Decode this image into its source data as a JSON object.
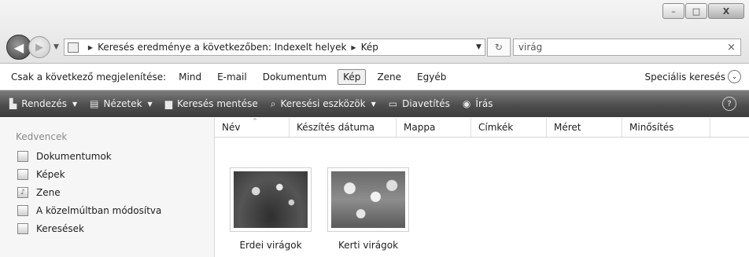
{
  "window": {
    "controls": {
      "minimize": "–",
      "maximize": "□",
      "close": "X"
    }
  },
  "nav": {
    "back_glyph": "◀",
    "forward_glyph": "▶",
    "history_drop": "▼",
    "breadcrumb": [
      "Keresés eredménye a következőben: Indexelt helyek",
      "Kép"
    ],
    "breadcrumb_sep": "▶",
    "address_drop": "▼",
    "refresh_glyph": "↻",
    "search_value": "virág",
    "search_clear": "×"
  },
  "filterbar": {
    "label": "Csak a következő megjelenítése:",
    "items": [
      "Mind",
      "E-mail",
      "Dokumentum",
      "Kép",
      "Zene",
      "Egyéb"
    ],
    "active_index": 3,
    "advanced": "Speciális keresés",
    "advanced_glyph": "⌄"
  },
  "toolbar": {
    "items": [
      {
        "label": "Rendezés",
        "icon": "organize-icon",
        "glyph": "▙",
        "dropdown": true
      },
      {
        "label": "Nézetek",
        "icon": "views-icon",
        "glyph": "▤",
        "dropdown": true
      },
      {
        "label": "Keresés mentése",
        "icon": "save-search-icon",
        "glyph": "▆",
        "dropdown": false
      },
      {
        "label": "Keresési eszközök",
        "icon": "search-tools-icon",
        "glyph": "⌕",
        "dropdown": true
      },
      {
        "label": "Diavetítés",
        "icon": "slideshow-icon",
        "glyph": "▭",
        "dropdown": false
      },
      {
        "label": "Írás",
        "icon": "burn-icon",
        "glyph": "◉",
        "dropdown": false
      }
    ],
    "dropdown_glyph": "▼",
    "help_glyph": "?"
  },
  "sidebar": {
    "heading": "Kedvencek",
    "items": [
      {
        "label": "Dokumentumok",
        "icon": "documents-icon",
        "glyph": ""
      },
      {
        "label": "Képek",
        "icon": "pictures-icon",
        "glyph": ""
      },
      {
        "label": "Zene",
        "icon": "music-icon",
        "glyph": "♪"
      },
      {
        "label": "A közelmúltban módosítva",
        "icon": "recent-icon",
        "glyph": ""
      },
      {
        "label": "Keresések",
        "icon": "searches-icon",
        "glyph": ""
      }
    ]
  },
  "list": {
    "sort_glyph": "^",
    "columns": [
      "Név",
      "Készítés dátuma",
      "Mappa",
      "Címkék",
      "Méret",
      "Minősítés"
    ],
    "files": [
      {
        "name": "Erdei virágok"
      },
      {
        "name": "Kerti virágok"
      }
    ]
  }
}
